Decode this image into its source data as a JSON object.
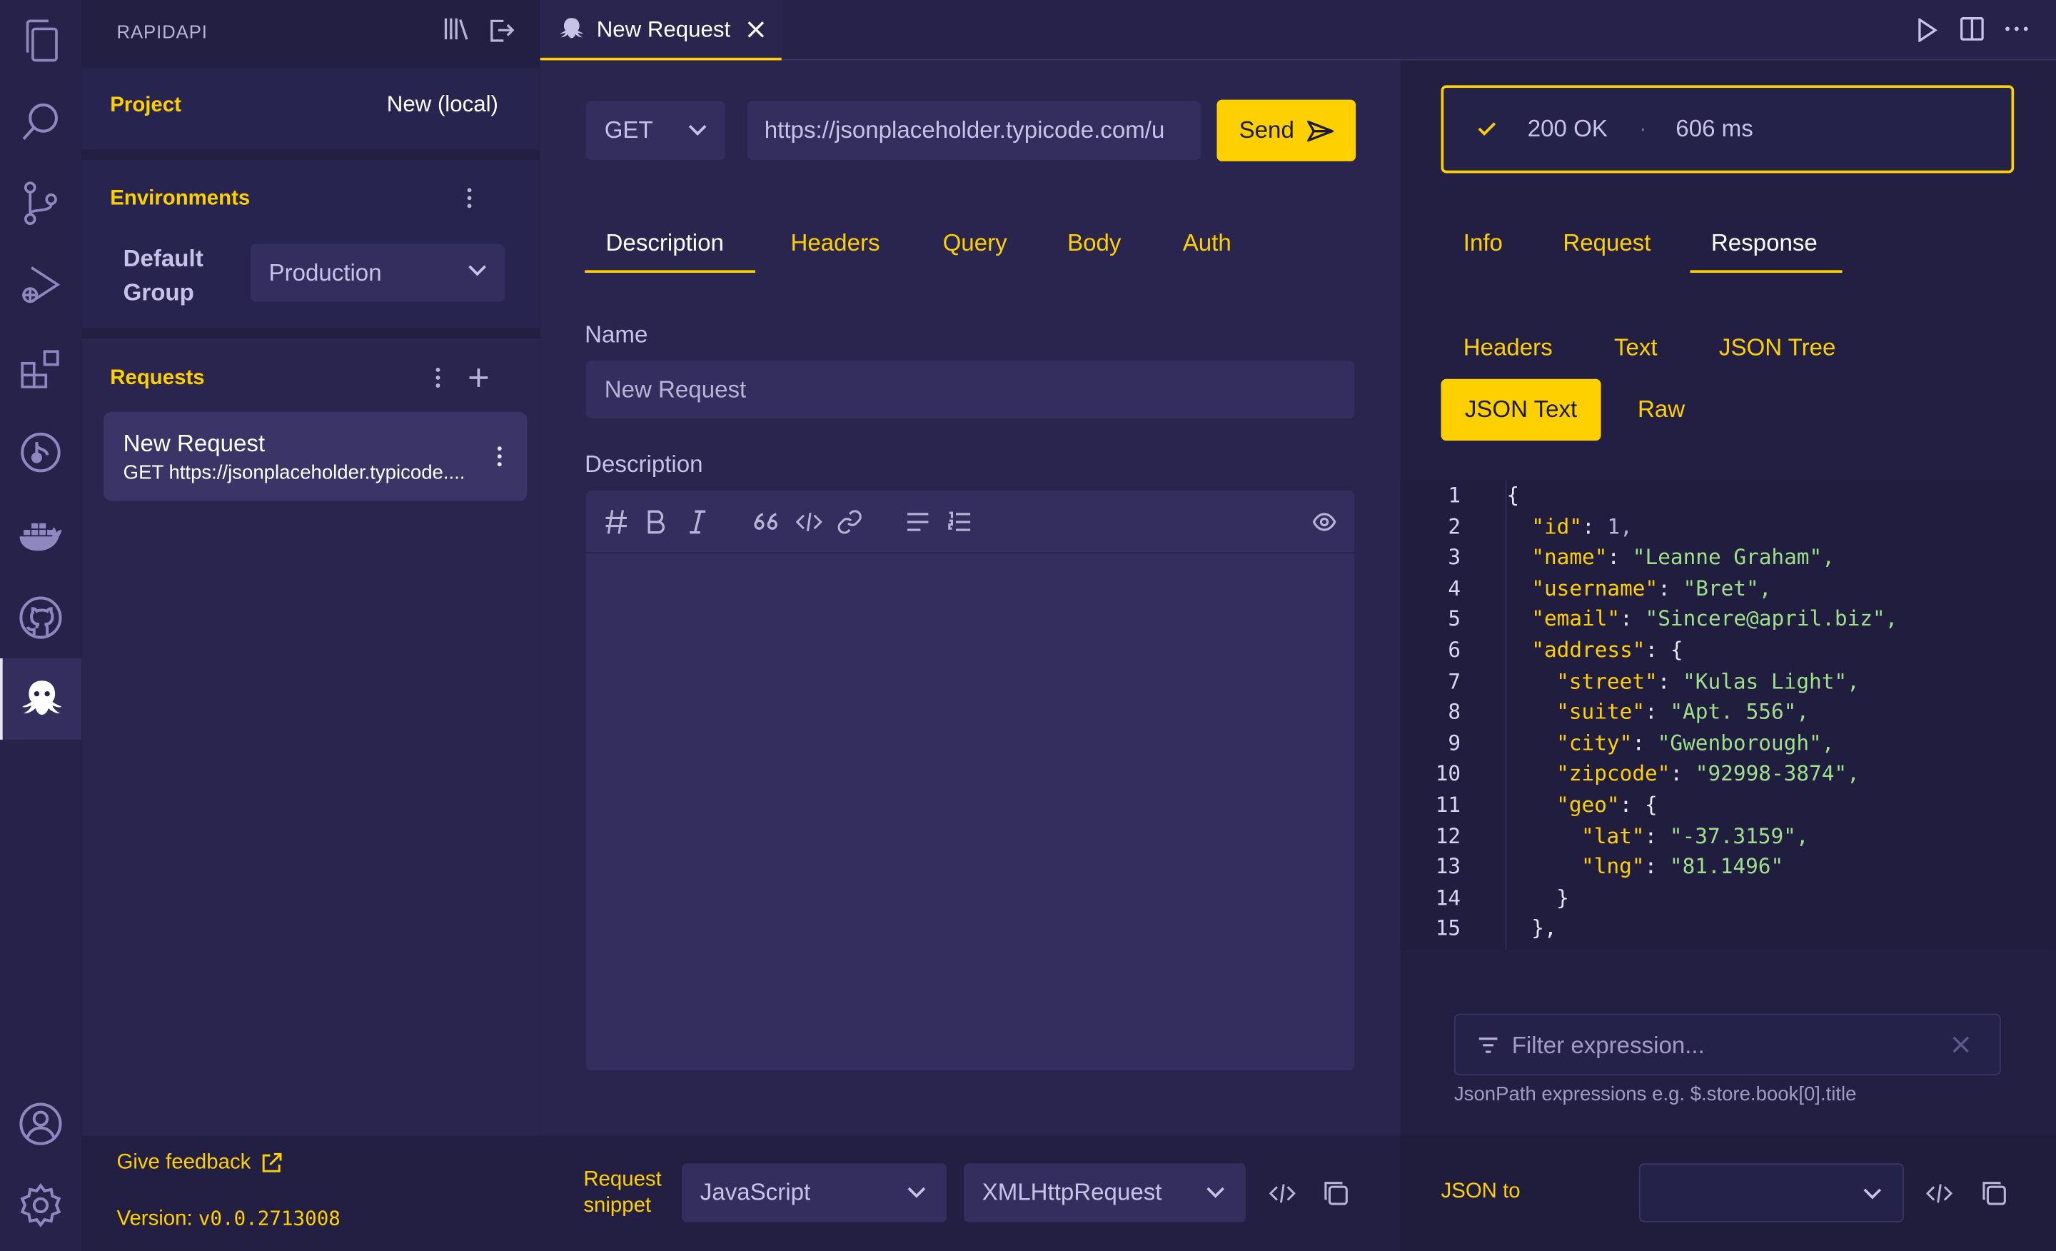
{
  "tab": {
    "title": "New Request"
  },
  "sidebar": {
    "header": "RAPIDAPI",
    "project_label": "Project",
    "project_value": "New (local)",
    "environments_label": "Environments",
    "env_group_line1": "Default",
    "env_group_line2": "Group",
    "env_value": "Production",
    "requests_label": "Requests",
    "request_item": {
      "name": "New Request",
      "url": "GET https://jsonplaceholder.typicode...."
    },
    "feedback": "Give feedback",
    "version_label": "Version:",
    "version_value": "v0.0.2713008"
  },
  "request": {
    "method": "GET",
    "url": "https://jsonplaceholder.typicode.com/u",
    "send": "Send",
    "tabs": [
      "Description",
      "Headers",
      "Query",
      "Body",
      "Auth"
    ],
    "name_label": "Name",
    "name_value": "New Request",
    "description_label": "Description"
  },
  "snippet": {
    "label_line1": "Request",
    "label_line2": "snippet",
    "language": "JavaScript",
    "library": "XMLHttpRequest"
  },
  "response": {
    "status": "200 OK",
    "sep": "·",
    "time": "606 ms",
    "tabs": [
      "Info",
      "Request",
      "Response"
    ],
    "subtabs": [
      "Headers",
      "Text",
      "JSON Tree"
    ],
    "subtabs2": [
      "JSON Text",
      "Raw"
    ],
    "filter_placeholder": "Filter expression...",
    "filter_hint": "JsonPath expressions e.g. $.store.book[0].title",
    "json_to_label": "JSON to"
  },
  "code_lines": [
    {
      "n": "1",
      "i": 0,
      "k": "",
      "v": "{",
      "t": "p"
    },
    {
      "n": "2",
      "i": 1,
      "k": "\"id\"",
      "v": "1,",
      "t": "num"
    },
    {
      "n": "3",
      "i": 1,
      "k": "\"name\"",
      "v": "\"Leanne Graham\",",
      "t": "str"
    },
    {
      "n": "4",
      "i": 1,
      "k": "\"username\"",
      "v": "\"Bret\",",
      "t": "str"
    },
    {
      "n": "5",
      "i": 1,
      "k": "\"email\"",
      "v": "\"Sincere@april.biz\",",
      "t": "str"
    },
    {
      "n": "6",
      "i": 1,
      "k": "\"address\"",
      "v": "{",
      "t": "p"
    },
    {
      "n": "7",
      "i": 2,
      "k": "\"street\"",
      "v": "\"Kulas Light\",",
      "t": "str"
    },
    {
      "n": "8",
      "i": 2,
      "k": "\"suite\"",
      "v": "\"Apt. 556\",",
      "t": "str"
    },
    {
      "n": "9",
      "i": 2,
      "k": "\"city\"",
      "v": "\"Gwenborough\",",
      "t": "str"
    },
    {
      "n": "10",
      "i": 2,
      "k": "\"zipcode\"",
      "v": "\"92998-3874\",",
      "t": "str"
    },
    {
      "n": "11",
      "i": 2,
      "k": "\"geo\"",
      "v": "{",
      "t": "p"
    },
    {
      "n": "12",
      "i": 3,
      "k": "\"lat\"",
      "v": "\"-37.3159\",",
      "t": "str"
    },
    {
      "n": "13",
      "i": 3,
      "k": "\"lng\"",
      "v": "\"81.1496\"",
      "t": "str"
    },
    {
      "n": "14",
      "i": 2,
      "k": "",
      "v": "}",
      "t": "p"
    },
    {
      "n": "15",
      "i": 1,
      "k": "",
      "v": "},",
      "t": "p"
    }
  ],
  "colors": {
    "accent": "#ffd000",
    "bg": "#1e1b3a",
    "panel": "#29254f",
    "string": "#9ee08a"
  }
}
